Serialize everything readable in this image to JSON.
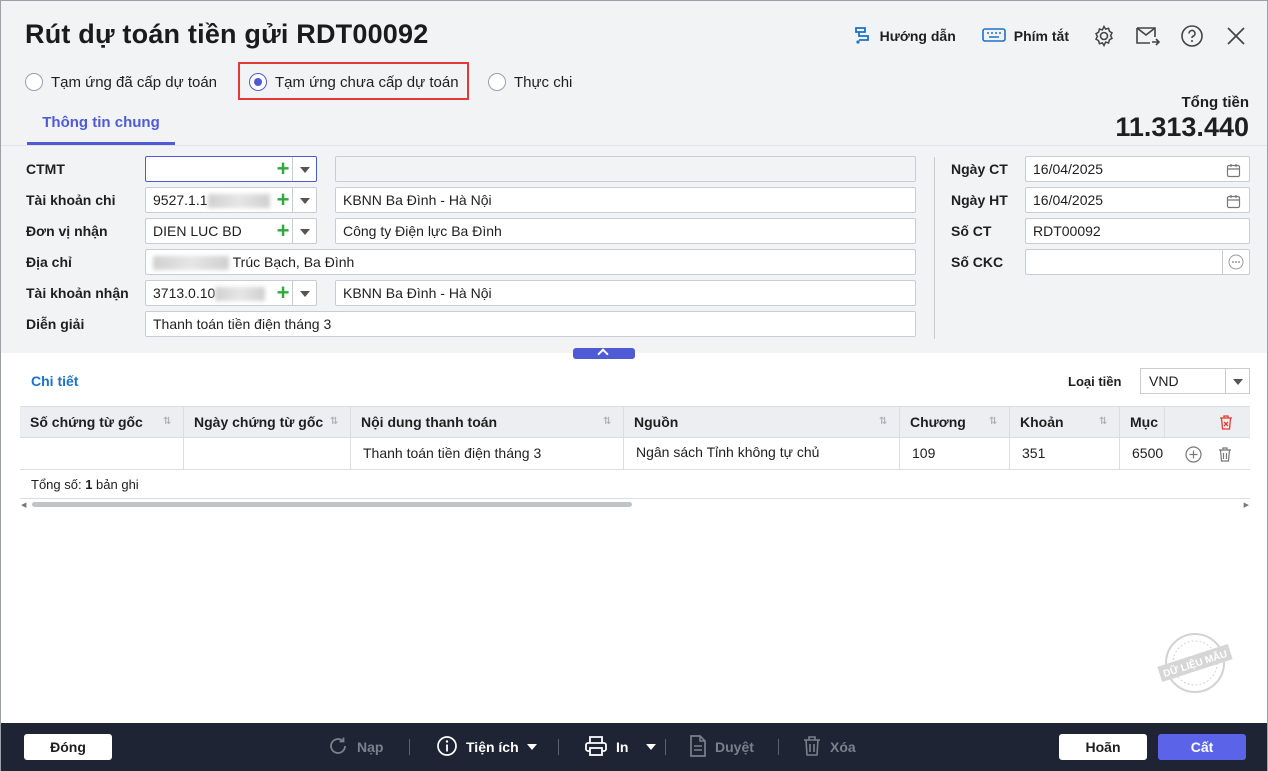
{
  "header": {
    "title": "Rút dự toán tiền gửi RDT00092",
    "guide_label": "Hướng dẫn",
    "shortcut_label": "Phím tắt"
  },
  "radios": {
    "opt1": "Tạm ứng đã cấp dự toán",
    "opt2": "Tạm ứng chưa cấp dự toán",
    "opt3": "Thực chi",
    "selected": "opt2"
  },
  "tab": {
    "general": "Thông tin chung"
  },
  "total": {
    "label": "Tổng tiền",
    "value": "11.313.440"
  },
  "form": {
    "ctmt_label": "CTMT",
    "ctmt_value": "",
    "ctmt_desc": "",
    "acct_out_label": "Tài khoản chi",
    "acct_out_value": "9527.1.1",
    "acct_out_desc": "KBNN Ba Đình  -  Hà Nội",
    "receiver_label": "Đơn vị nhận",
    "receiver_value": "DIEN LUC BD",
    "receiver_desc": "Công ty Điện lực Ba Đình",
    "address_label": "Địa chỉ",
    "address_value": "Trúc Bạch, Ba Đình",
    "acct_in_label": "Tài khoản nhận",
    "acct_in_value": "3713.0.10",
    "acct_in_desc": "KBNN Ba Đình  -  Hà Nội",
    "note_label": "Diễn giải",
    "note_value": "Thanh toán tiền điện tháng 3",
    "date_ct_label": "Ngày CT",
    "date_ct_value": "16/04/2025",
    "date_ht_label": "Ngày HT",
    "date_ht_value": "16/04/2025",
    "no_ct_label": "Số CT",
    "no_ct_value": "RDT00092",
    "no_ckc_label": "Số CKC",
    "no_ckc_value": ""
  },
  "detail": {
    "title": "Chi tiết",
    "currency_label": "Loại tiền",
    "currency_value": "VND",
    "columns": [
      "Số chứng từ gốc",
      "Ngày chứng từ gốc",
      "Nội dung thanh toán",
      "Nguồn",
      "Chương",
      "Khoản",
      "Mục"
    ],
    "rows": [
      [
        "",
        "",
        "Thanh toán tiền điện tháng 3",
        "Ngân sách Tỉnh không tự chủ",
        "109",
        "351",
        "6500"
      ]
    ],
    "footer_prefix": "Tổng số: ",
    "footer_count": "1",
    "footer_suffix": " bản ghi"
  },
  "stamp": {
    "text": "DỮ LIỆU MẪU"
  },
  "toolbar": {
    "close": "Đóng",
    "reload": "Nạp",
    "utility": "Tiện ích",
    "print": "In",
    "approve": "Duyệt",
    "delete": "Xóa",
    "cancel": "Hoãn",
    "save": "Cất"
  },
  "colors": {
    "accent": "#4f5bd5",
    "highlight_border": "#e53935",
    "footer_bg": "#1e2433",
    "link": "#1a73c8"
  }
}
